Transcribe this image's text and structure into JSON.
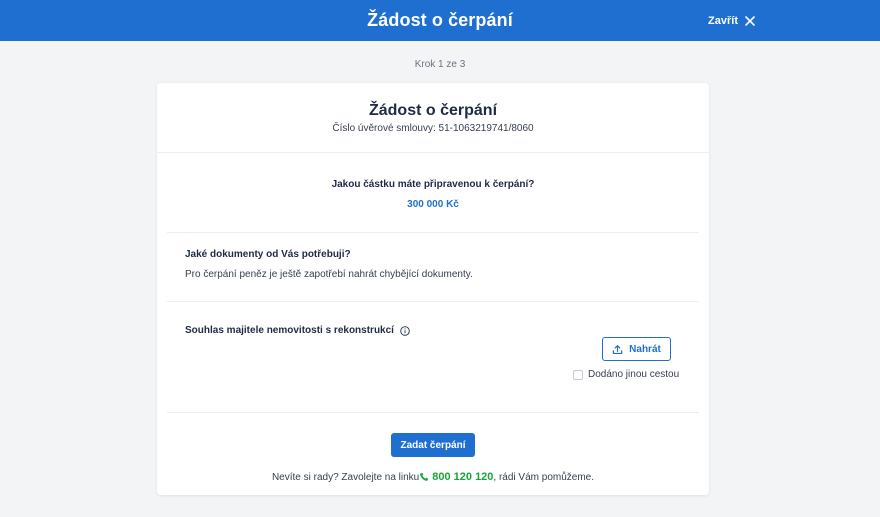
{
  "header": {
    "title": "Žádost o čerpání",
    "close_label": "Zavřít",
    "bg_color": "#1f6fd1"
  },
  "step": {
    "text": "Krok 1 ze 3"
  },
  "card": {
    "title": "Žádost o čerpání",
    "contract": "Číslo úvěrové smlouvy: 51-1063219741/8060",
    "amount": {
      "question": "Jakou částku máte připravenou k čerpání?",
      "value": "300 000 Kč"
    },
    "documents": {
      "question": "Jaké dokumenty od Vás potřebuji?",
      "description": "Pro čerpání peněz je ještě zapotřebí nahrát chybějící dokumenty."
    },
    "upload": {
      "label": "Souhlas majitele nemovitosti s rekonstrukcí",
      "upload_button": "Nahrát",
      "delivered_label": "Dodáno jinou cestou",
      "delivered_checked": false
    },
    "submit_label": "Zadat čerpání",
    "help": {
      "text_before": "Nevíte si rady? Zavolejte na linku",
      "phone": "800 120 120",
      "text_after": ", rádi Vám pomůžeme."
    }
  },
  "icons": {
    "close": "close-icon",
    "info": "info-icon",
    "upload": "upload-icon",
    "phone": "phone-icon"
  },
  "colors": {
    "accent": "#1f6fd1",
    "phone": "#1aa33a",
    "background": "#f3f4f6"
  }
}
